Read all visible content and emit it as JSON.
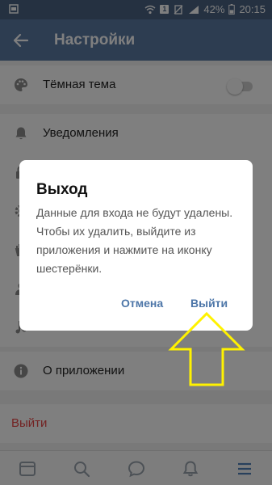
{
  "status_bar": {
    "battery": "42%",
    "time": "20:15",
    "sim": "1"
  },
  "header": {
    "title": "Настройки"
  },
  "settings": {
    "dark_theme": {
      "label": "Тёмная тема",
      "enabled": false
    },
    "notifications": {
      "label": "Уведомления"
    },
    "about": {
      "label": "О приложении"
    },
    "logout": {
      "label": "Выйти"
    }
  },
  "dialog": {
    "title": "Выход",
    "message": "Данные для входа не будут удалены. Чтобы их удалить, выйдите из приложения и нажмите на иконку шестерёнки.",
    "cancel_label": "Отмена",
    "confirm_label": "Выйти"
  },
  "bottom_nav": {
    "items": [
      {
        "icon": "news-icon"
      },
      {
        "icon": "search-icon"
      },
      {
        "icon": "messages-icon"
      },
      {
        "icon": "notifications-icon"
      },
      {
        "icon": "menu-icon",
        "active": true
      }
    ]
  },
  "colors": {
    "header": "#5b7aa3",
    "accent": "#4d76a8",
    "danger": "#e64646",
    "annotation": "#fff200"
  }
}
